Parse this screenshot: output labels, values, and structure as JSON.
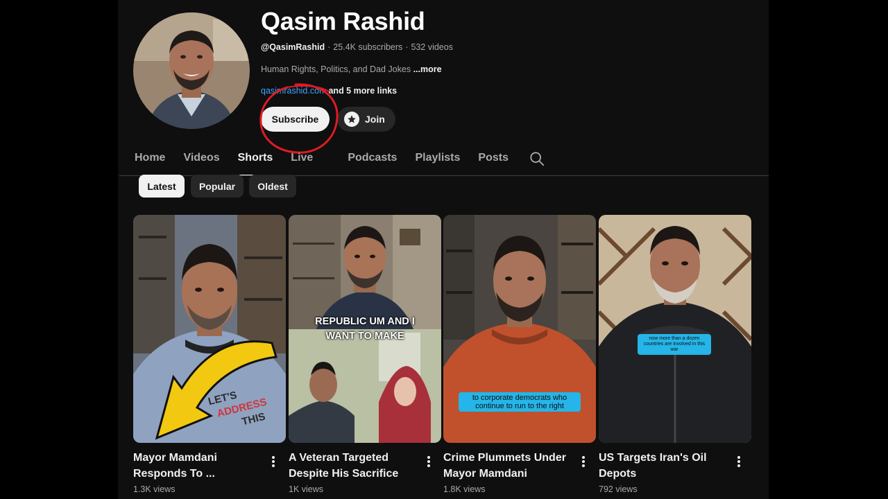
{
  "channel": {
    "name": "Qasim Rashid",
    "handle": "@QasimRashid",
    "subscribers": "25.4K subscribers",
    "videos": "532 videos",
    "description": "Human Rights, Politics, and Dad Jokes",
    "more_label": "...more",
    "link": "qasimrashid.com",
    "more_links": "and 5 more links"
  },
  "actions": {
    "subscribe_label": "Subscribe",
    "join_label": "Join"
  },
  "tabs": [
    {
      "label": "Home"
    },
    {
      "label": "Videos"
    },
    {
      "label": "Shorts",
      "active": true
    },
    {
      "label": "Live"
    },
    {
      "label": "Podcasts"
    },
    {
      "label": "Playlists"
    },
    {
      "label": "Posts"
    }
  ],
  "chips": [
    {
      "label": "Latest",
      "active": true
    },
    {
      "label": "Popular"
    },
    {
      "label": "Oldest"
    }
  ],
  "shorts": [
    {
      "title": "Mayor Mamdani Responds To ...",
      "views": "1.3K views",
      "overlay": "LET'S ADDRESS THIS"
    },
    {
      "title": "A Veteran Targeted Despite His Sacrifice",
      "views": "1K views",
      "overlay": "REPUBLIC UM AND I WANT TO MAKE"
    },
    {
      "title": "Crime Plummets Under Mayor Mamdani",
      "views": "1.8K views",
      "overlay": "to corporate democrats who continue to run to the right"
    },
    {
      "title": "US Targets Iran's Oil Depots",
      "views": "792 views",
      "overlay": "now more than a dozen countries are involved in this war"
    }
  ],
  "colors": {
    "background": "#0f0f0f",
    "link": "#3ea6ff",
    "annotation_circle": "#e01b24",
    "caption_box": "#25b5e8",
    "arrow": "#f2c811"
  }
}
